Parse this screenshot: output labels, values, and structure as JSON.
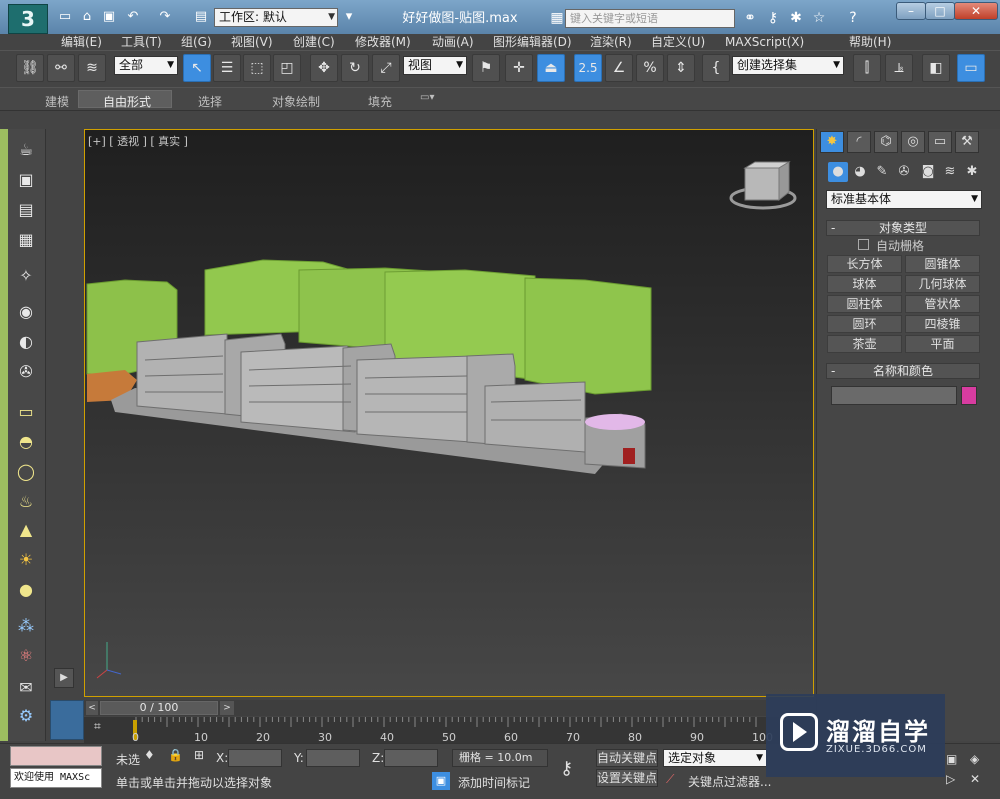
{
  "titlebar": {
    "logo": "3",
    "workspace_label": "工作区: 默认",
    "title": "好好做图-贴图.max",
    "search_placeholder": "键入关键字或短语"
  },
  "menu": [
    "编辑(E)",
    "工具(T)",
    "组(G)",
    "视图(V)",
    "创建(C)",
    "修改器(M)",
    "动画(A)",
    "图形编辑器(D)",
    "渲染(R)",
    "自定义(U)",
    "MAXScript(X)",
    "帮助(H)"
  ],
  "toolbar": {
    "filter_value": "全部",
    "coord_value": "视图",
    "snap_value": "2.5",
    "selection_set_placeholder": "创建选择集"
  },
  "ribbon_tabs": [
    "建模",
    "自由形式",
    "选择",
    "对象绘制",
    "填充"
  ],
  "viewport": {
    "label": "[+] [ 透视 ] [ 真实 ]"
  },
  "command_panel": {
    "category": "标准基本体",
    "object_type_header": "对象类型",
    "autogrid_label": "自动栅格",
    "object_buttons": [
      "长方体",
      "圆锥体",
      "球体",
      "几何球体",
      "圆柱体",
      "管状体",
      "圆环",
      "四棱锥",
      "茶壶",
      "平面"
    ],
    "name_color_header": "名称和颜色",
    "swatch_color": "#d83ca0"
  },
  "timeline": {
    "frame_display": "0 / 100",
    "ticks": [
      "0",
      "10",
      "20",
      "30",
      "40",
      "50",
      "60",
      "70",
      "80",
      "90",
      "100"
    ]
  },
  "status": {
    "welcome": "欢迎使用 MAXSc",
    "selection_state": "未选",
    "x_label": "X:",
    "y_label": "Y:",
    "z_label": "Z:",
    "grid": "栅格 = 10.0m",
    "auto_key": "自动关键点",
    "set_key": "设置关键点",
    "selected_object": "选定对象",
    "key_filter": "关键点过滤器...",
    "prompt": "单击或单击并拖动以选择对象",
    "add_time_tag": "添加时间标记"
  },
  "watermark": {
    "title": "溜溜自学",
    "url": "ZIXUE.3D66.COM"
  }
}
